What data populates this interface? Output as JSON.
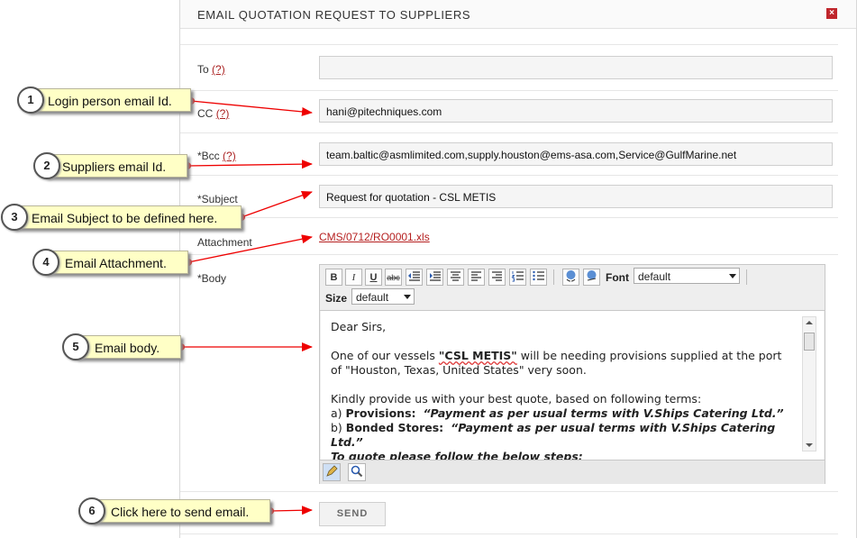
{
  "dialog": {
    "title": "EMAIL QUOTATION REQUEST TO SUPPLIERS",
    "close_glyph": "×"
  },
  "form": {
    "to_label": "To",
    "to_help": "(?)",
    "to_value": "",
    "cc_label": "CC",
    "cc_help": "(?)",
    "cc_value": "hani@pitechniques.com",
    "bcc_label": "*Bcc",
    "bcc_help": "(?)",
    "bcc_value": "team.baltic@asmlimited.com,supply.houston@ems-asa.com,Service@GulfMarine.net",
    "subject_label": "*Subject",
    "subject_value": "Request for quotation - CSL METIS",
    "attachment_label": "Attachment",
    "attachment_value": "CMS/0712/RO0001.xls",
    "body_label": "*Body"
  },
  "editor": {
    "toolbar": {
      "bold": "B",
      "italic": "I",
      "underline": "U",
      "strike": "abc",
      "font_label": "Font",
      "font_value": "default",
      "size_label": "Size",
      "size_value": "default"
    },
    "body": {
      "greeting": "Dear Sirs,",
      "line1_pre": "One of our vessels ",
      "vessel": "\"CSL METIS\"",
      "line1_post": " will be needing provisions supplied at the port of \"Houston, Texas, United States\" very soon.",
      "line2": "Kindly provide us with your best quote, based on following terms:",
      "a_prefix": "a) ",
      "a_label": "Provisions:",
      "a_terms": "“Payment as per usual terms with V.Ships Catering Ltd.”",
      "b_prefix": "b) ",
      "b_label": "Bonded Stores:",
      "b_terms": "“Payment as per usual terms with V.Ships Catering Ltd.”",
      "partial": "To quote please follow the below steps:"
    }
  },
  "send_label": "SEND",
  "annotations": [
    {
      "num": "1",
      "text": "Login person email Id."
    },
    {
      "num": "2",
      "text": "Suppliers email Id."
    },
    {
      "num": "3",
      "text": "Email Subject to be defined here."
    },
    {
      "num": "4",
      "text": "Email Attachment."
    },
    {
      "num": "5",
      "text": "Email body."
    },
    {
      "num": "6",
      "text": "Click here to send email."
    }
  ],
  "colors": {
    "accent_red": "#c0262c",
    "callout_bg": "#ffffc6",
    "link": "#b51f1f"
  }
}
